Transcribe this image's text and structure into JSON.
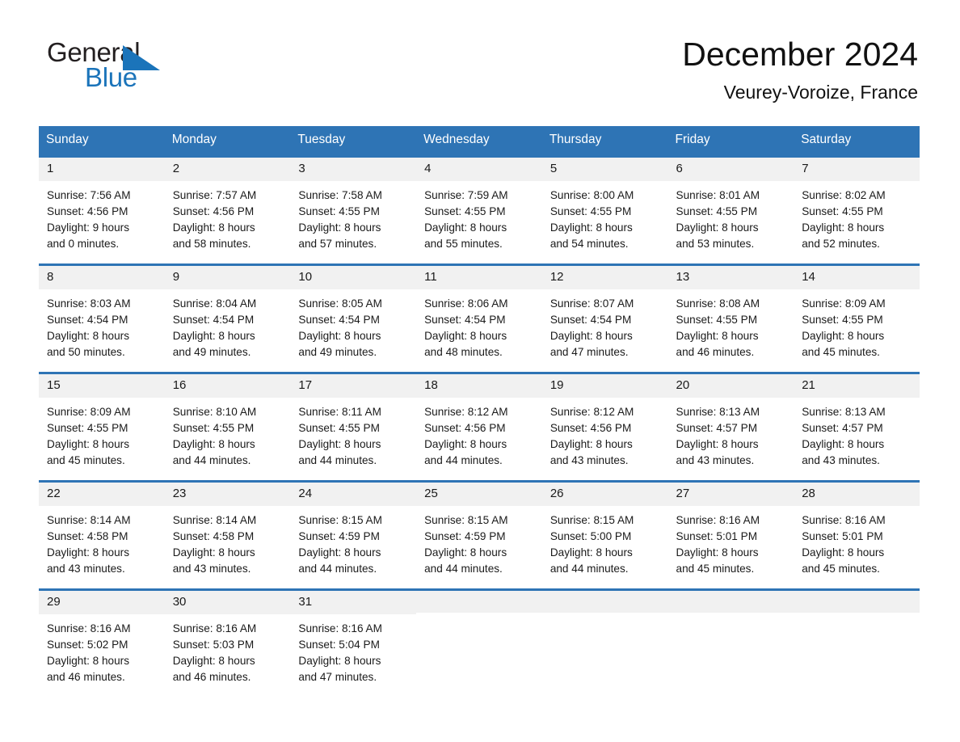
{
  "brand": {
    "word_one": "General",
    "word_two": "Blue",
    "triangle_color": "#1b74ba",
    "logo_icon": "general-blue-logo"
  },
  "header": {
    "title": "December 2024",
    "subtitle": "Veurey-Voroize, France"
  },
  "theme": {
    "header_blue": "#2e74b5",
    "daynum_background": "#f1f1f1",
    "page_background": "#ffffff",
    "text_color": "#1a1a1a"
  },
  "calendar": {
    "month": "December",
    "year": "2024",
    "location": "Veurey-Voroize, France",
    "weekday_headers": [
      "Sunday",
      "Monday",
      "Tuesday",
      "Wednesday",
      "Thursday",
      "Friday",
      "Saturday"
    ],
    "labels": {
      "sunrise_prefix": "Sunrise:",
      "sunset_prefix": "Sunset:",
      "daylight_prefix": "Daylight:"
    },
    "weeks": [
      [
        {
          "day": "1",
          "sunrise": "Sunrise: 7:56 AM",
          "sunset": "Sunset: 4:56 PM",
          "daylight_line1": "Daylight: 9 hours",
          "daylight_line2": "and 0 minutes."
        },
        {
          "day": "2",
          "sunrise": "Sunrise: 7:57 AM",
          "sunset": "Sunset: 4:56 PM",
          "daylight_line1": "Daylight: 8 hours",
          "daylight_line2": "and 58 minutes."
        },
        {
          "day": "3",
          "sunrise": "Sunrise: 7:58 AM",
          "sunset": "Sunset: 4:55 PM",
          "daylight_line1": "Daylight: 8 hours",
          "daylight_line2": "and 57 minutes."
        },
        {
          "day": "4",
          "sunrise": "Sunrise: 7:59 AM",
          "sunset": "Sunset: 4:55 PM",
          "daylight_line1": "Daylight: 8 hours",
          "daylight_line2": "and 55 minutes."
        },
        {
          "day": "5",
          "sunrise": "Sunrise: 8:00 AM",
          "sunset": "Sunset: 4:55 PM",
          "daylight_line1": "Daylight: 8 hours",
          "daylight_line2": "and 54 minutes."
        },
        {
          "day": "6",
          "sunrise": "Sunrise: 8:01 AM",
          "sunset": "Sunset: 4:55 PM",
          "daylight_line1": "Daylight: 8 hours",
          "daylight_line2": "and 53 minutes."
        },
        {
          "day": "7",
          "sunrise": "Sunrise: 8:02 AM",
          "sunset": "Sunset: 4:55 PM",
          "daylight_line1": "Daylight: 8 hours",
          "daylight_line2": "and 52 minutes."
        }
      ],
      [
        {
          "day": "8",
          "sunrise": "Sunrise: 8:03 AM",
          "sunset": "Sunset: 4:54 PM",
          "daylight_line1": "Daylight: 8 hours",
          "daylight_line2": "and 50 minutes."
        },
        {
          "day": "9",
          "sunrise": "Sunrise: 8:04 AM",
          "sunset": "Sunset: 4:54 PM",
          "daylight_line1": "Daylight: 8 hours",
          "daylight_line2": "and 49 minutes."
        },
        {
          "day": "10",
          "sunrise": "Sunrise: 8:05 AM",
          "sunset": "Sunset: 4:54 PM",
          "daylight_line1": "Daylight: 8 hours",
          "daylight_line2": "and 49 minutes."
        },
        {
          "day": "11",
          "sunrise": "Sunrise: 8:06 AM",
          "sunset": "Sunset: 4:54 PM",
          "daylight_line1": "Daylight: 8 hours",
          "daylight_line2": "and 48 minutes."
        },
        {
          "day": "12",
          "sunrise": "Sunrise: 8:07 AM",
          "sunset": "Sunset: 4:54 PM",
          "daylight_line1": "Daylight: 8 hours",
          "daylight_line2": "and 47 minutes."
        },
        {
          "day": "13",
          "sunrise": "Sunrise: 8:08 AM",
          "sunset": "Sunset: 4:55 PM",
          "daylight_line1": "Daylight: 8 hours",
          "daylight_line2": "and 46 minutes."
        },
        {
          "day": "14",
          "sunrise": "Sunrise: 8:09 AM",
          "sunset": "Sunset: 4:55 PM",
          "daylight_line1": "Daylight: 8 hours",
          "daylight_line2": "and 45 minutes."
        }
      ],
      [
        {
          "day": "15",
          "sunrise": "Sunrise: 8:09 AM",
          "sunset": "Sunset: 4:55 PM",
          "daylight_line1": "Daylight: 8 hours",
          "daylight_line2": "and 45 minutes."
        },
        {
          "day": "16",
          "sunrise": "Sunrise: 8:10 AM",
          "sunset": "Sunset: 4:55 PM",
          "daylight_line1": "Daylight: 8 hours",
          "daylight_line2": "and 44 minutes."
        },
        {
          "day": "17",
          "sunrise": "Sunrise: 8:11 AM",
          "sunset": "Sunset: 4:55 PM",
          "daylight_line1": "Daylight: 8 hours",
          "daylight_line2": "and 44 minutes."
        },
        {
          "day": "18",
          "sunrise": "Sunrise: 8:12 AM",
          "sunset": "Sunset: 4:56 PM",
          "daylight_line1": "Daylight: 8 hours",
          "daylight_line2": "and 44 minutes."
        },
        {
          "day": "19",
          "sunrise": "Sunrise: 8:12 AM",
          "sunset": "Sunset: 4:56 PM",
          "daylight_line1": "Daylight: 8 hours",
          "daylight_line2": "and 43 minutes."
        },
        {
          "day": "20",
          "sunrise": "Sunrise: 8:13 AM",
          "sunset": "Sunset: 4:57 PM",
          "daylight_line1": "Daylight: 8 hours",
          "daylight_line2": "and 43 minutes."
        },
        {
          "day": "21",
          "sunrise": "Sunrise: 8:13 AM",
          "sunset": "Sunset: 4:57 PM",
          "daylight_line1": "Daylight: 8 hours",
          "daylight_line2": "and 43 minutes."
        }
      ],
      [
        {
          "day": "22",
          "sunrise": "Sunrise: 8:14 AM",
          "sunset": "Sunset: 4:58 PM",
          "daylight_line1": "Daylight: 8 hours",
          "daylight_line2": "and 43 minutes."
        },
        {
          "day": "23",
          "sunrise": "Sunrise: 8:14 AM",
          "sunset": "Sunset: 4:58 PM",
          "daylight_line1": "Daylight: 8 hours",
          "daylight_line2": "and 43 minutes."
        },
        {
          "day": "24",
          "sunrise": "Sunrise: 8:15 AM",
          "sunset": "Sunset: 4:59 PM",
          "daylight_line1": "Daylight: 8 hours",
          "daylight_line2": "and 44 minutes."
        },
        {
          "day": "25",
          "sunrise": "Sunrise: 8:15 AM",
          "sunset": "Sunset: 4:59 PM",
          "daylight_line1": "Daylight: 8 hours",
          "daylight_line2": "and 44 minutes."
        },
        {
          "day": "26",
          "sunrise": "Sunrise: 8:15 AM",
          "sunset": "Sunset: 5:00 PM",
          "daylight_line1": "Daylight: 8 hours",
          "daylight_line2": "and 44 minutes."
        },
        {
          "day": "27",
          "sunrise": "Sunrise: 8:16 AM",
          "sunset": "Sunset: 5:01 PM",
          "daylight_line1": "Daylight: 8 hours",
          "daylight_line2": "and 45 minutes."
        },
        {
          "day": "28",
          "sunrise": "Sunrise: 8:16 AM",
          "sunset": "Sunset: 5:01 PM",
          "daylight_line1": "Daylight: 8 hours",
          "daylight_line2": "and 45 minutes."
        }
      ],
      [
        {
          "day": "29",
          "sunrise": "Sunrise: 8:16 AM",
          "sunset": "Sunset: 5:02 PM",
          "daylight_line1": "Daylight: 8 hours",
          "daylight_line2": "and 46 minutes."
        },
        {
          "day": "30",
          "sunrise": "Sunrise: 8:16 AM",
          "sunset": "Sunset: 5:03 PM",
          "daylight_line1": "Daylight: 8 hours",
          "daylight_line2": "and 46 minutes."
        },
        {
          "day": "31",
          "sunrise": "Sunrise: 8:16 AM",
          "sunset": "Sunset: 5:04 PM",
          "daylight_line1": "Daylight: 8 hours",
          "daylight_line2": "and 47 minutes."
        },
        {
          "day": "",
          "sunrise": "",
          "sunset": "",
          "daylight_line1": "",
          "daylight_line2": ""
        },
        {
          "day": "",
          "sunrise": "",
          "sunset": "",
          "daylight_line1": "",
          "daylight_line2": ""
        },
        {
          "day": "",
          "sunrise": "",
          "sunset": "",
          "daylight_line1": "",
          "daylight_line2": ""
        },
        {
          "day": "",
          "sunrise": "",
          "sunset": "",
          "daylight_line1": "",
          "daylight_line2": ""
        }
      ]
    ]
  }
}
